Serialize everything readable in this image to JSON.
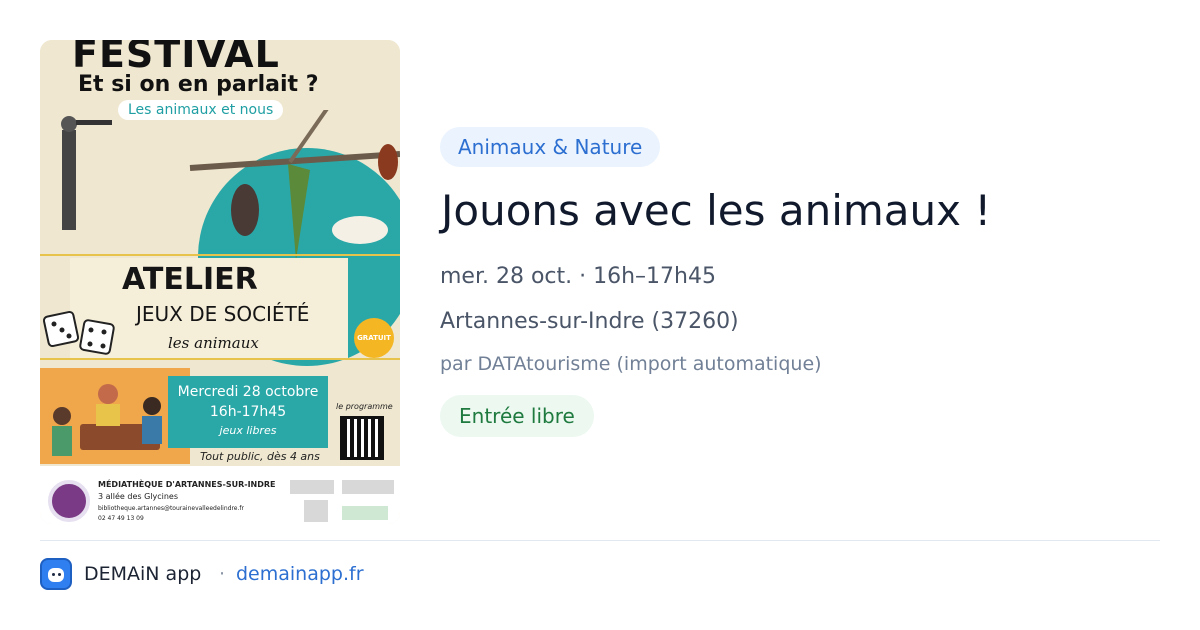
{
  "event": {
    "category": "Animaux & Nature",
    "title": "Jouons avec les animaux !",
    "datetime": "mer. 28 oct. · 16h–17h45",
    "location": "Artannes-sur-Indre (37260)",
    "author": "par DATAtourisme (import automatique)",
    "price": "Entrée libre"
  },
  "poster": {
    "festival": "FESTIVAL",
    "subtitle": "Et si on en parlait ?",
    "theme": "Les animaux et nous",
    "atelier": "ATELIER",
    "jeux": "JEUX DE SOCIÉTÉ",
    "les_animaux": "les animaux",
    "gratuit": "GRATUIT",
    "date": "Mercredi 28 octobre",
    "time": "16h-17h45",
    "jeux_libres": "jeux libres",
    "public": "Tout public, dès 4 ans",
    "programme": "le programme",
    "mediatheque": "MÉDIATHÈQUE D'ARTANNES-SUR-INDRE",
    "address": "3 allée des Glycines",
    "email": "bibliotheque.artannes@tourainevalleedelindre.fr",
    "phone": "02 47 49 13 09"
  },
  "footer": {
    "app_name": "DEMAiN app",
    "separator": "·",
    "url": "demainapp.fr"
  },
  "colors": {
    "tag_bg": "#eaf3fe",
    "tag_text": "#2c6fd1",
    "price_bg": "#ecf8f0",
    "price_text": "#1e7a3e",
    "poster_teal": "#2aa8a8"
  }
}
